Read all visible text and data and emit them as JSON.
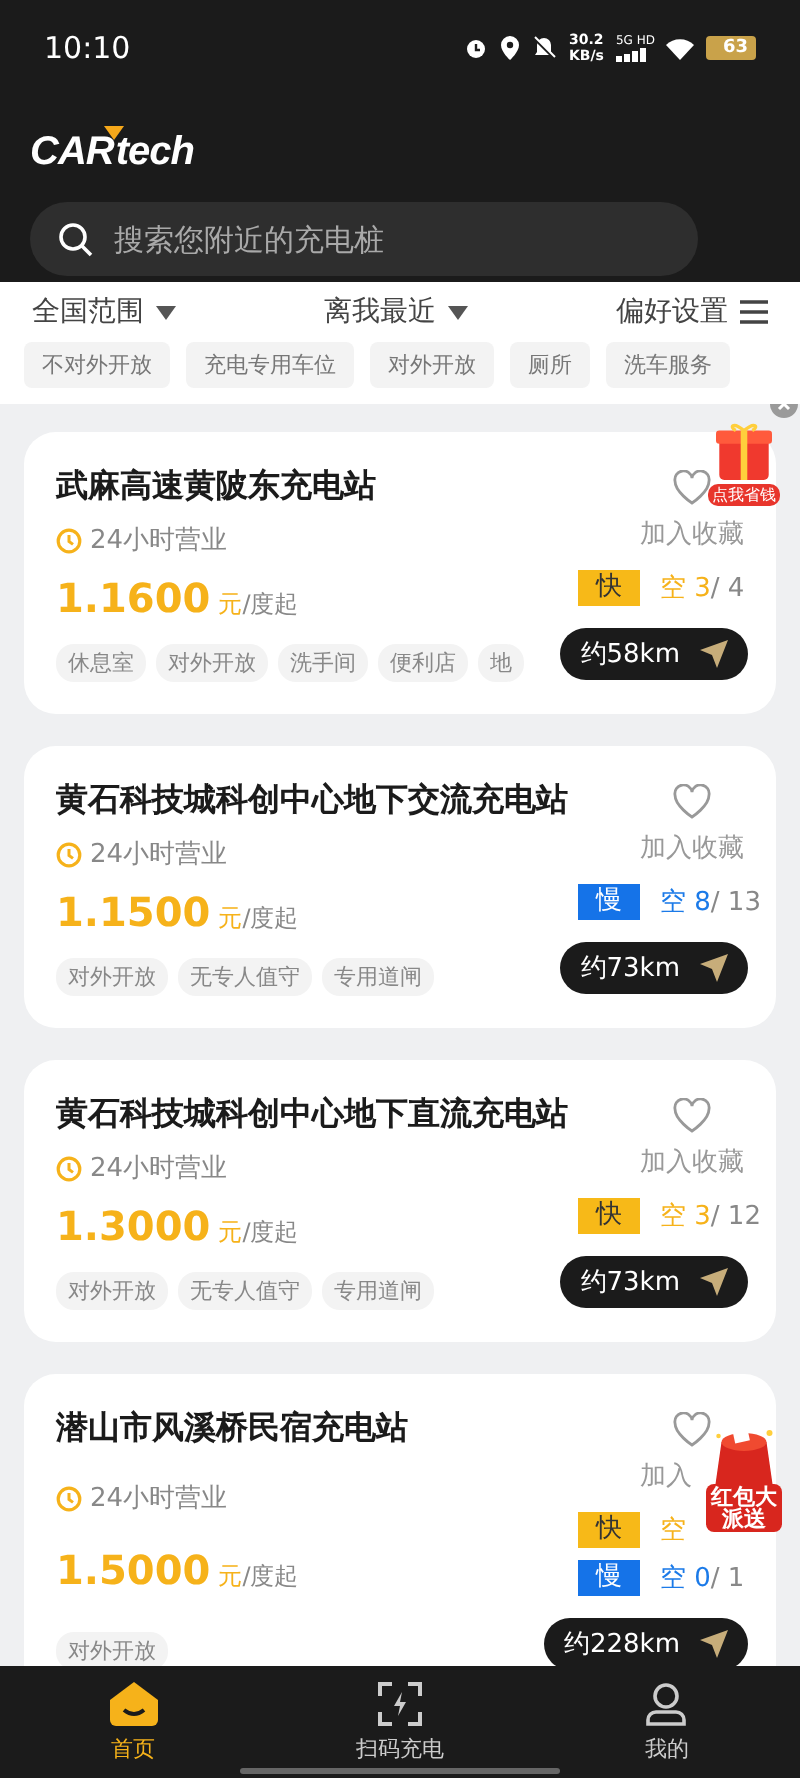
{
  "status_bar": {
    "time": "10:10",
    "speed": "30.2",
    "speed_unit": "KB/s",
    "network": "5G HD",
    "battery": "63"
  },
  "logo": {
    "brand": "CAR",
    "suffix": "tech"
  },
  "search": {
    "placeholder": "搜索您附近的充电桩"
  },
  "filters": [
    {
      "label": "全国范围",
      "kind": "dropdown"
    },
    {
      "label": "离我最近",
      "kind": "dropdown"
    },
    {
      "label": "偏好设置",
      "kind": "menu"
    }
  ],
  "tags": [
    "不对外开放",
    "充电专用车位",
    "对外开放",
    "厕所",
    "洗车服务"
  ],
  "stations": [
    {
      "name": "武麻高速黄陂东充电站",
      "hours": "24小时营业",
      "price": "1.1600",
      "unit": "元",
      "per": "/度起",
      "favorite_label": "加入收藏",
      "chargers": [
        {
          "kind": "fast",
          "label": "快",
          "free": "空 3",
          "total": "/ 4"
        }
      ],
      "distance": "约58km",
      "tags": [
        "休息室",
        "对外开放",
        "洗手间",
        "便利店",
        "地"
      ]
    },
    {
      "name": "黄石科技城科创中心地下交流充电站",
      "hours": "24小时营业",
      "price": "1.1500",
      "unit": "元",
      "per": "/度起",
      "favorite_label": "加入收藏",
      "chargers": [
        {
          "kind": "slow",
          "label": "慢",
          "free": "空 8",
          "total": "/ 13"
        }
      ],
      "distance": "约73km",
      "tags": [
        "对外开放",
        "无专人值守",
        "专用道闸"
      ]
    },
    {
      "name": "黄石科技城科创中心地下直流充电站",
      "hours": "24小时营业",
      "price": "1.3000",
      "unit": "元",
      "per": "/度起",
      "favorite_label": "加入收藏",
      "chargers": [
        {
          "kind": "fast",
          "label": "快",
          "free": "空 3",
          "total": "/ 12"
        }
      ],
      "distance": "约73km",
      "tags": [
        "对外开放",
        "无专人值守",
        "专用道闸"
      ]
    },
    {
      "name": "潜山市风溪桥民宿充电站",
      "hours": "24小时营业",
      "price": "1.5000",
      "unit": "元",
      "per": "/度起",
      "favorite_label": "加入",
      "chargers": [
        {
          "kind": "fast",
          "label": "快",
          "free": "空"
        },
        {
          "kind": "slow",
          "label": "慢",
          "free": "空 0",
          "total": "/ 1"
        }
      ],
      "distance": "约228km",
      "tags": [
        "对外开放"
      ]
    }
  ],
  "promos": [
    {
      "kind": "gift",
      "text": "点我省钱"
    },
    {
      "kind": "envelope",
      "text": "红包大派送"
    }
  ],
  "nav": [
    {
      "label": "首页",
      "kind": "home",
      "selected": true
    },
    {
      "label": "扫码充电",
      "kind": "scan",
      "selected": false
    },
    {
      "label": "我的",
      "kind": "user",
      "selected": false
    }
  ]
}
